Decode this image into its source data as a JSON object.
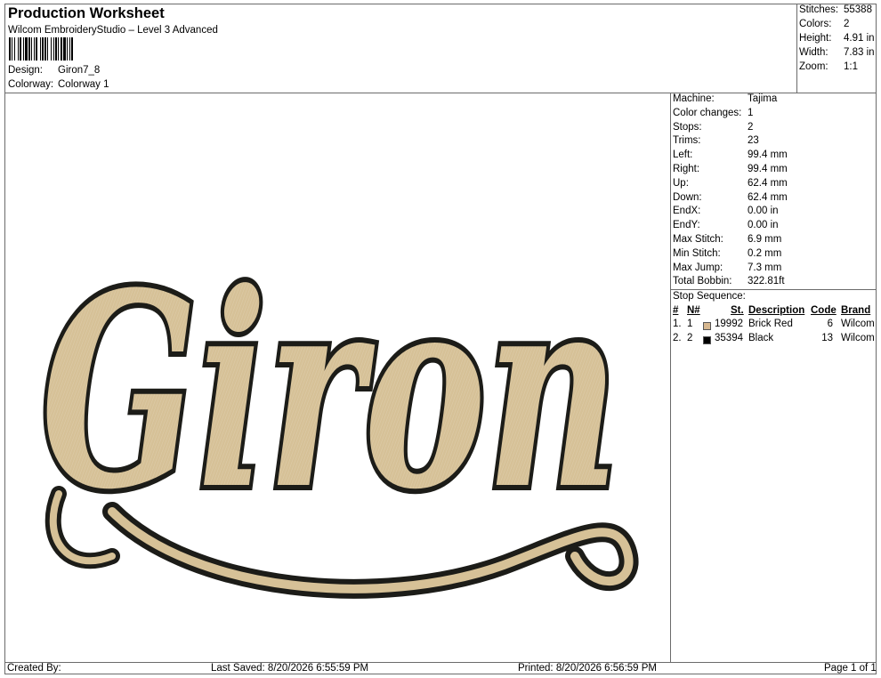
{
  "header": {
    "title": "Production Worksheet",
    "subtitle": "Wilcom EmbroideryStudio – Level 3 Advanced",
    "design_label": "Design:",
    "design_value": "Giron7_8",
    "colorway_label": "Colorway:",
    "colorway_value": "Colorway 1"
  },
  "summary": {
    "stitches_label": "Stitches:",
    "stitches": "55388",
    "colors_label": "Colors:",
    "colors": "2",
    "height_label": "Height:",
    "height": "4.91 in",
    "width_label": "Width:",
    "width": "7.83 in",
    "zoom_label": "Zoom:",
    "zoom": "1:1"
  },
  "machine_info": [
    {
      "label": "Machine:",
      "value": "Tajima"
    },
    {
      "label": "Color changes:",
      "value": "1"
    },
    {
      "label": "Stops:",
      "value": "2"
    },
    {
      "label": "Trims:",
      "value": "23"
    },
    {
      "label": "Left:",
      "value": "99.4 mm"
    },
    {
      "label": "Right:",
      "value": "99.4 mm"
    },
    {
      "label": "Up:",
      "value": "62.4 mm"
    },
    {
      "label": "Down:",
      "value": "62.4 mm"
    },
    {
      "label": "EndX:",
      "value": "0.00 in"
    },
    {
      "label": "EndY:",
      "value": "0.00 in"
    },
    {
      "label": "Max Stitch:",
      "value": "6.9 mm"
    },
    {
      "label": "Min Stitch:",
      "value": "0.2 mm"
    },
    {
      "label": "Max Jump:",
      "value": "7.3 mm"
    },
    {
      "label": "Total Bobbin:",
      "value": "322.81ft"
    }
  ],
  "stop_sequence": {
    "title": "Stop Sequence:",
    "headers": {
      "num": "#",
      "needle": "N#",
      "stitches": "St.",
      "description": "Description",
      "code": "Code",
      "brand": "Brand"
    },
    "rows": [
      {
        "num": "1.",
        "needle": "1",
        "color": "#d6b78f",
        "stitches": "19992",
        "description": "Brick Red",
        "code": "6",
        "brand": "Wilcom"
      },
      {
        "num": "2.",
        "needle": "2",
        "color": "#000000",
        "stitches": "35394",
        "description": "Black",
        "code": "13",
        "brand": "Wilcom"
      }
    ]
  },
  "design": {
    "text": "Giron",
    "fill_color": "#d6c197",
    "outline_color": "#1c1c18"
  },
  "footer": {
    "created_by": "Created By:",
    "last_saved": "Last Saved: 8/20/2026 6:55:59 PM",
    "printed": "Printed: 8/20/2026 6:56:59 PM",
    "page": "Page 1 of 1"
  }
}
